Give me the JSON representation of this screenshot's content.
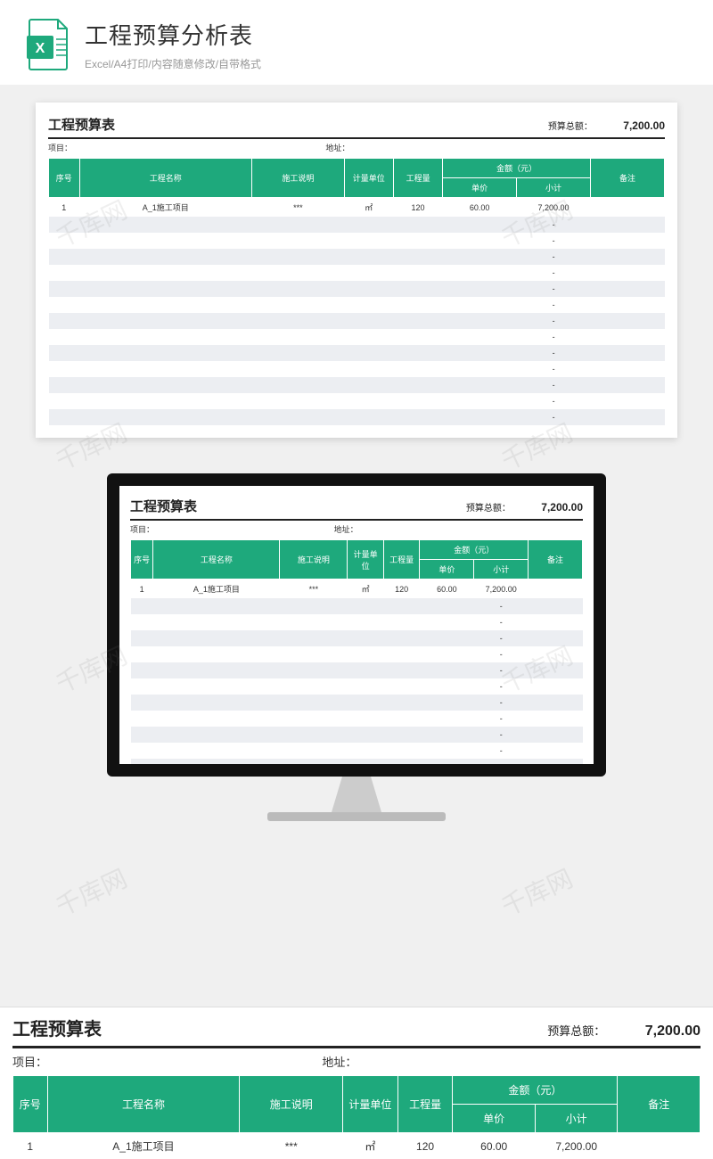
{
  "header": {
    "title": "工程预算分析表",
    "subtitle": "Excel/A4打印/内容随意修改/自带格式"
  },
  "sheet": {
    "title": "工程预算表",
    "total_label": "预算总额：",
    "total_value": "7,200.00",
    "meta_project_label": "项目：",
    "meta_address_label": "地址：",
    "columns": {
      "seq": "序号",
      "name": "工程名称",
      "desc": "施工说明",
      "unit": "计量单位",
      "qty": "工程量",
      "amount_group": "金额（元）",
      "price": "单价",
      "subtotal": "小计",
      "note": "备注"
    },
    "rows": [
      {
        "seq": "1",
        "name": "A_1施工项目",
        "desc": "***",
        "unit": "㎡",
        "qty": "120",
        "price": "60.00",
        "subtotal": "7,200.00",
        "note": ""
      },
      {
        "seq": "",
        "name": "",
        "desc": "",
        "unit": "",
        "qty": "",
        "price": "",
        "subtotal": "-",
        "note": ""
      },
      {
        "seq": "",
        "name": "",
        "desc": "",
        "unit": "",
        "qty": "",
        "price": "",
        "subtotal": "-",
        "note": ""
      },
      {
        "seq": "",
        "name": "",
        "desc": "",
        "unit": "",
        "qty": "",
        "price": "",
        "subtotal": "-",
        "note": ""
      },
      {
        "seq": "",
        "name": "",
        "desc": "",
        "unit": "",
        "qty": "",
        "price": "",
        "subtotal": "-",
        "note": ""
      },
      {
        "seq": "",
        "name": "",
        "desc": "",
        "unit": "",
        "qty": "",
        "price": "",
        "subtotal": "-",
        "note": ""
      },
      {
        "seq": "",
        "name": "",
        "desc": "",
        "unit": "",
        "qty": "",
        "price": "",
        "subtotal": "-",
        "note": ""
      },
      {
        "seq": "",
        "name": "",
        "desc": "",
        "unit": "",
        "qty": "",
        "price": "",
        "subtotal": "-",
        "note": ""
      },
      {
        "seq": "",
        "name": "",
        "desc": "",
        "unit": "",
        "qty": "",
        "price": "",
        "subtotal": "-",
        "note": ""
      },
      {
        "seq": "",
        "name": "",
        "desc": "",
        "unit": "",
        "qty": "",
        "price": "",
        "subtotal": "-",
        "note": ""
      },
      {
        "seq": "",
        "name": "",
        "desc": "",
        "unit": "",
        "qty": "",
        "price": "",
        "subtotal": "-",
        "note": ""
      },
      {
        "seq": "",
        "name": "",
        "desc": "",
        "unit": "",
        "qty": "",
        "price": "",
        "subtotal": "-",
        "note": ""
      },
      {
        "seq": "",
        "name": "",
        "desc": "",
        "unit": "",
        "qty": "",
        "price": "",
        "subtotal": "-",
        "note": ""
      },
      {
        "seq": "",
        "name": "",
        "desc": "",
        "unit": "",
        "qty": "",
        "price": "",
        "subtotal": "-",
        "note": ""
      }
    ]
  },
  "watermark_text": "千库网"
}
